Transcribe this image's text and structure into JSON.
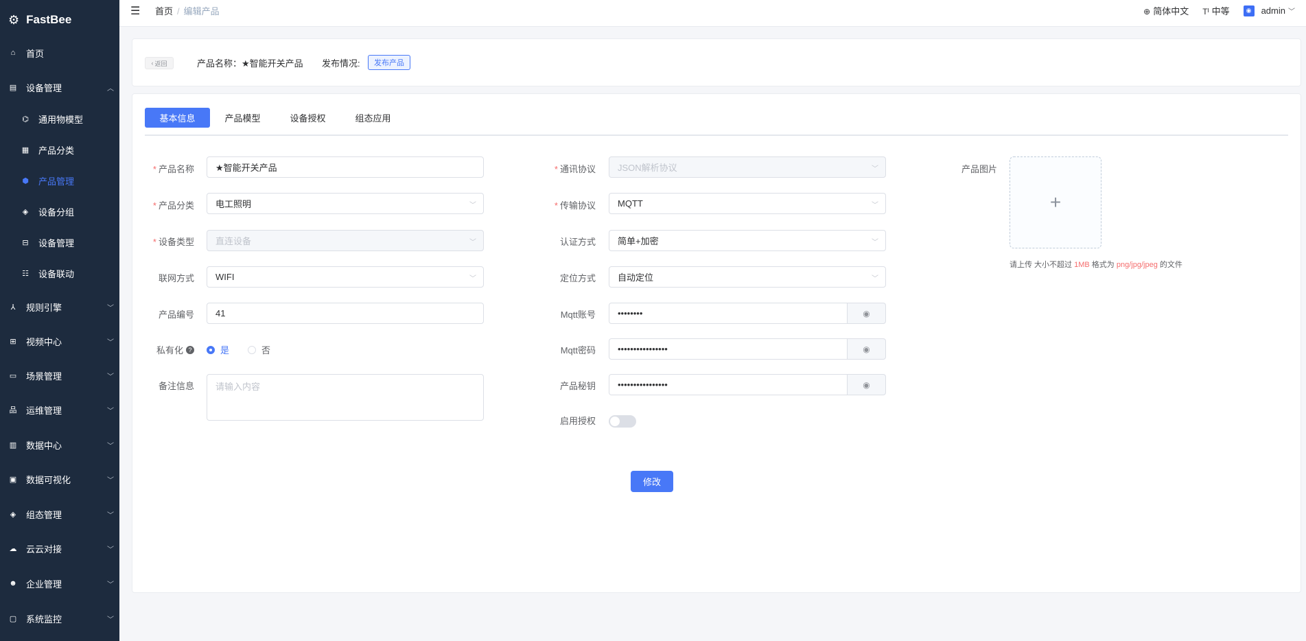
{
  "app": {
    "name": "FastBee"
  },
  "sidebar": {
    "items": [
      {
        "label": "首页",
        "icon": "home-icon"
      },
      {
        "label": "设备管理",
        "icon": "device-icon",
        "expanded": true,
        "children": [
          {
            "label": "通用物模型",
            "icon": "model-icon"
          },
          {
            "label": "产品分类",
            "icon": "category-icon"
          },
          {
            "label": "产品管理",
            "icon": "product-icon",
            "active": true
          },
          {
            "label": "设备分组",
            "icon": "group-icon"
          },
          {
            "label": "设备管理",
            "icon": "device-mgmt-icon"
          },
          {
            "label": "设备联动",
            "icon": "linkage-icon"
          }
        ]
      },
      {
        "label": "规则引擎",
        "icon": "rule-icon"
      },
      {
        "label": "视频中心",
        "icon": "video-icon"
      },
      {
        "label": "场景管理",
        "icon": "scene-icon"
      },
      {
        "label": "运维管理",
        "icon": "ops-icon"
      },
      {
        "label": "数据中心",
        "icon": "data-icon"
      },
      {
        "label": "数据可视化",
        "icon": "visual-icon"
      },
      {
        "label": "组态管理",
        "icon": "config-icon"
      },
      {
        "label": "云云对接",
        "icon": "cloud-icon"
      },
      {
        "label": "企业管理",
        "icon": "enterprise-icon"
      },
      {
        "label": "系统监控",
        "icon": "monitor-icon"
      }
    ]
  },
  "topbar": {
    "breadcrumb": [
      "首页",
      "编辑产品"
    ],
    "language": "简体中文",
    "size": "中等",
    "user": "admin"
  },
  "header_card": {
    "back_label": "返回",
    "product_name_label": "产品名称：★智能开关产品",
    "publish_label": "发布情况:",
    "publish_tag": "发布产品"
  },
  "tabs": [
    "基本信息",
    "产品模型",
    "设备授权",
    "组态应用"
  ],
  "form": {
    "product_name": {
      "label": "产品名称",
      "value": "★智能开关产品"
    },
    "category": {
      "label": "产品分类",
      "value": "电工照明"
    },
    "device_type": {
      "label": "设备类型",
      "value": "直连设备"
    },
    "network": {
      "label": "联网方式",
      "value": "WIFI"
    },
    "product_id": {
      "label": "产品编号",
      "value": "41"
    },
    "private": {
      "label": "私有化",
      "yes": "是",
      "no": "否",
      "help": "?"
    },
    "remark": {
      "label": "备注信息",
      "placeholder": "请输入内容"
    },
    "protocol": {
      "label": "通讯协议",
      "value": "JSON解析协议"
    },
    "transport": {
      "label": "传输协议",
      "value": "MQTT"
    },
    "auth": {
      "label": "认证方式",
      "value": "简单+加密"
    },
    "location": {
      "label": "定位方式",
      "value": "自动定位"
    },
    "mqtt_account": {
      "label": "Mqtt账号",
      "value": "••••••••"
    },
    "mqtt_password": {
      "label": "Mqtt密码",
      "value": "••••••••••••••••"
    },
    "product_secret": {
      "label": "产品秘钥",
      "value": "••••••••••••••••"
    },
    "enable_auth": {
      "label": "启用授权"
    },
    "image": {
      "label": "产品图片",
      "plus": "+"
    },
    "upload_tip": {
      "prefix": "请上传 大小不超过 ",
      "size": "1MB",
      "mid": " 格式为 ",
      "formats": "png/jpg/jpeg",
      "suffix": " 的文件"
    },
    "submit": "修改"
  }
}
